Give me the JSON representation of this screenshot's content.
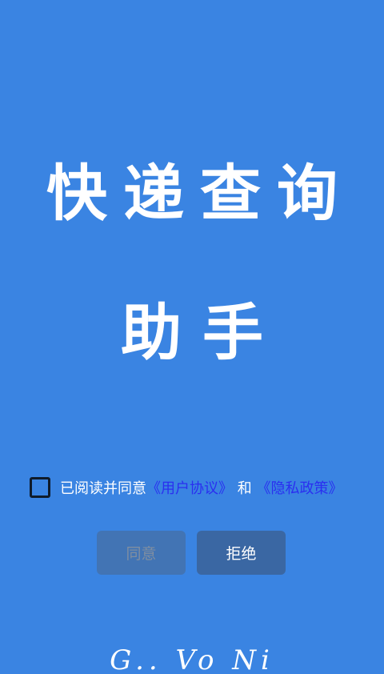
{
  "app": {
    "title_line1": "快递查询",
    "title_line2": "助手"
  },
  "consent": {
    "checked": false,
    "prefix": "已阅读并同意",
    "user_agreement_link": "《用户协议》",
    "conjunction": "和",
    "privacy_policy_link": "《隐私政策》"
  },
  "buttons": {
    "agree_label": "同意",
    "reject_label": "拒绝"
  },
  "footer": {
    "signature": "G.. Vo Ni"
  },
  "colors": {
    "background": "#3a84e2",
    "link": "#2a2ff0",
    "agree_disabled_bg": "#4274b4",
    "reject_bg": "#3a67a3"
  }
}
